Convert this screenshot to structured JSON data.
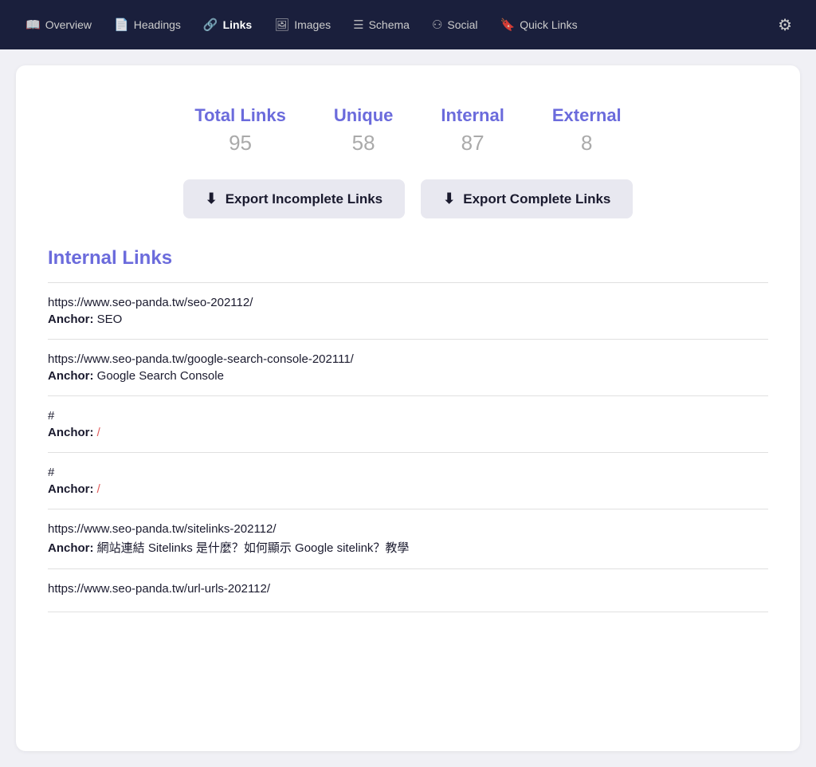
{
  "nav": {
    "items": [
      {
        "id": "overview",
        "label": "Overview",
        "icon": "📖",
        "active": false
      },
      {
        "id": "headings",
        "label": "Headings",
        "icon": "📄",
        "active": false
      },
      {
        "id": "links",
        "label": "Links",
        "icon": "🔗",
        "active": true
      },
      {
        "id": "images",
        "label": "Images",
        "icon": "🖼",
        "active": false
      },
      {
        "id": "schema",
        "label": "Schema",
        "icon": "≡",
        "active": false
      },
      {
        "id": "social",
        "label": "Social",
        "icon": "⚇",
        "active": false
      },
      {
        "id": "quicklinks",
        "label": "Quick Links",
        "icon": "🔖",
        "active": false
      }
    ],
    "settings_icon": "⚙"
  },
  "stats": {
    "total_links": {
      "label": "Total Links",
      "value": "95"
    },
    "unique": {
      "label": "Unique",
      "value": "58"
    },
    "internal": {
      "label": "Internal",
      "value": "87"
    },
    "external": {
      "label": "External",
      "value": "8"
    }
  },
  "buttons": {
    "export_incomplete": "Export Incomplete Links",
    "export_complete": "Export Complete Links"
  },
  "internal_links_section": {
    "title": "Internal Links",
    "links": [
      {
        "url": "https://www.seo-panda.tw/seo-202112/",
        "anchor": "SEO",
        "anchor_type": "normal"
      },
      {
        "url": "https://www.seo-panda.tw/google-search-console-202111/",
        "anchor": "Google Search Console",
        "anchor_type": "normal"
      },
      {
        "url": "#",
        "anchor": "/",
        "anchor_type": "slash"
      },
      {
        "url": "#",
        "anchor": "/",
        "anchor_type": "slash"
      },
      {
        "url": "https://www.seo-panda.tw/sitelinks-202112/",
        "anchor": "網站連結 Sitelinks 是什麼？如何顯示 Google sitelink？教學",
        "anchor_type": "normal"
      },
      {
        "url": "https://www.seo-panda.tw/url-urls-202112/",
        "anchor": "",
        "anchor_type": "normal"
      }
    ]
  }
}
